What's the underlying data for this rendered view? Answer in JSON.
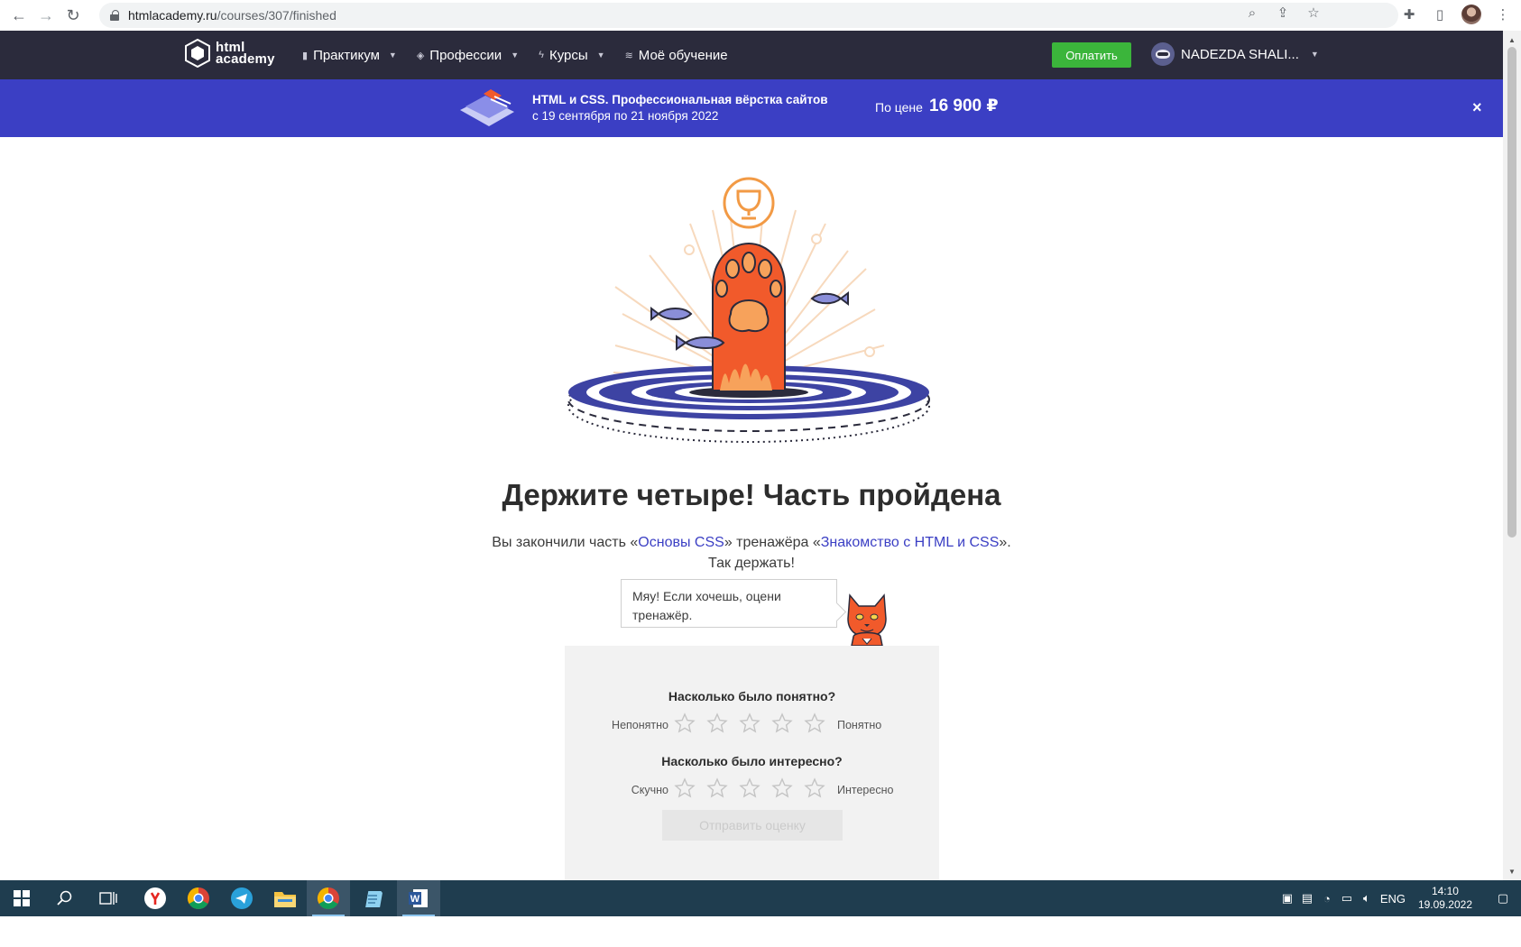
{
  "browser": {
    "url_domain": "htmlacademy.ru",
    "url_path": "/courses/307/finished"
  },
  "header": {
    "logo_line1": "html",
    "logo_line2": "academy",
    "menu": [
      {
        "label": "Практикум",
        "has_caret": true
      },
      {
        "label": "Профессии",
        "has_caret": true
      },
      {
        "label": "Курсы",
        "has_caret": true
      },
      {
        "label": "Моё обучение",
        "has_caret": false
      }
    ],
    "pay_label": "Оплатить",
    "user_name": "NADEZDA SHALI..."
  },
  "promo": {
    "title": "HTML и CSS. Профессиональная вёрстка сайтов",
    "dates": "с 19 сентября по 21 ноября 2022",
    "price_label": "По цене",
    "price": "16 900 ₽",
    "close": "×"
  },
  "main": {
    "title": "Держите четыре! Часть пройдена",
    "sub_prefix": "Вы закончили часть «",
    "link1": "Основы CSS",
    "sub_mid": "» тренажёра «",
    "link2": "Знакомство с HTML и CSS",
    "sub_suffix": "».",
    "sub_line2": "Так держать!",
    "bubble": "Мяу! Если хочешь, оцени тренажёр."
  },
  "rating": {
    "q1": "Насколько было понятно?",
    "q1_left": "Непонятно",
    "q1_right": "Понятно",
    "q2": "Насколько было интересно?",
    "q2_left": "Скучно",
    "q2_right": "Интересно",
    "submit": "Отправить оценку",
    "q1_value": 0,
    "q2_value": 0,
    "max_stars": 5
  },
  "taskbar": {
    "lang": "ENG",
    "time": "14:10",
    "date": "19.09.2022"
  },
  "colors": {
    "header_bg": "#2b2b3c",
    "promo_bg": "#3b3fc4",
    "pay_green": "#3bb53b",
    "link_blue": "#3b3fc4",
    "paw_orange": "#f15a2b",
    "taskbar_bg": "#1f3d4f"
  }
}
